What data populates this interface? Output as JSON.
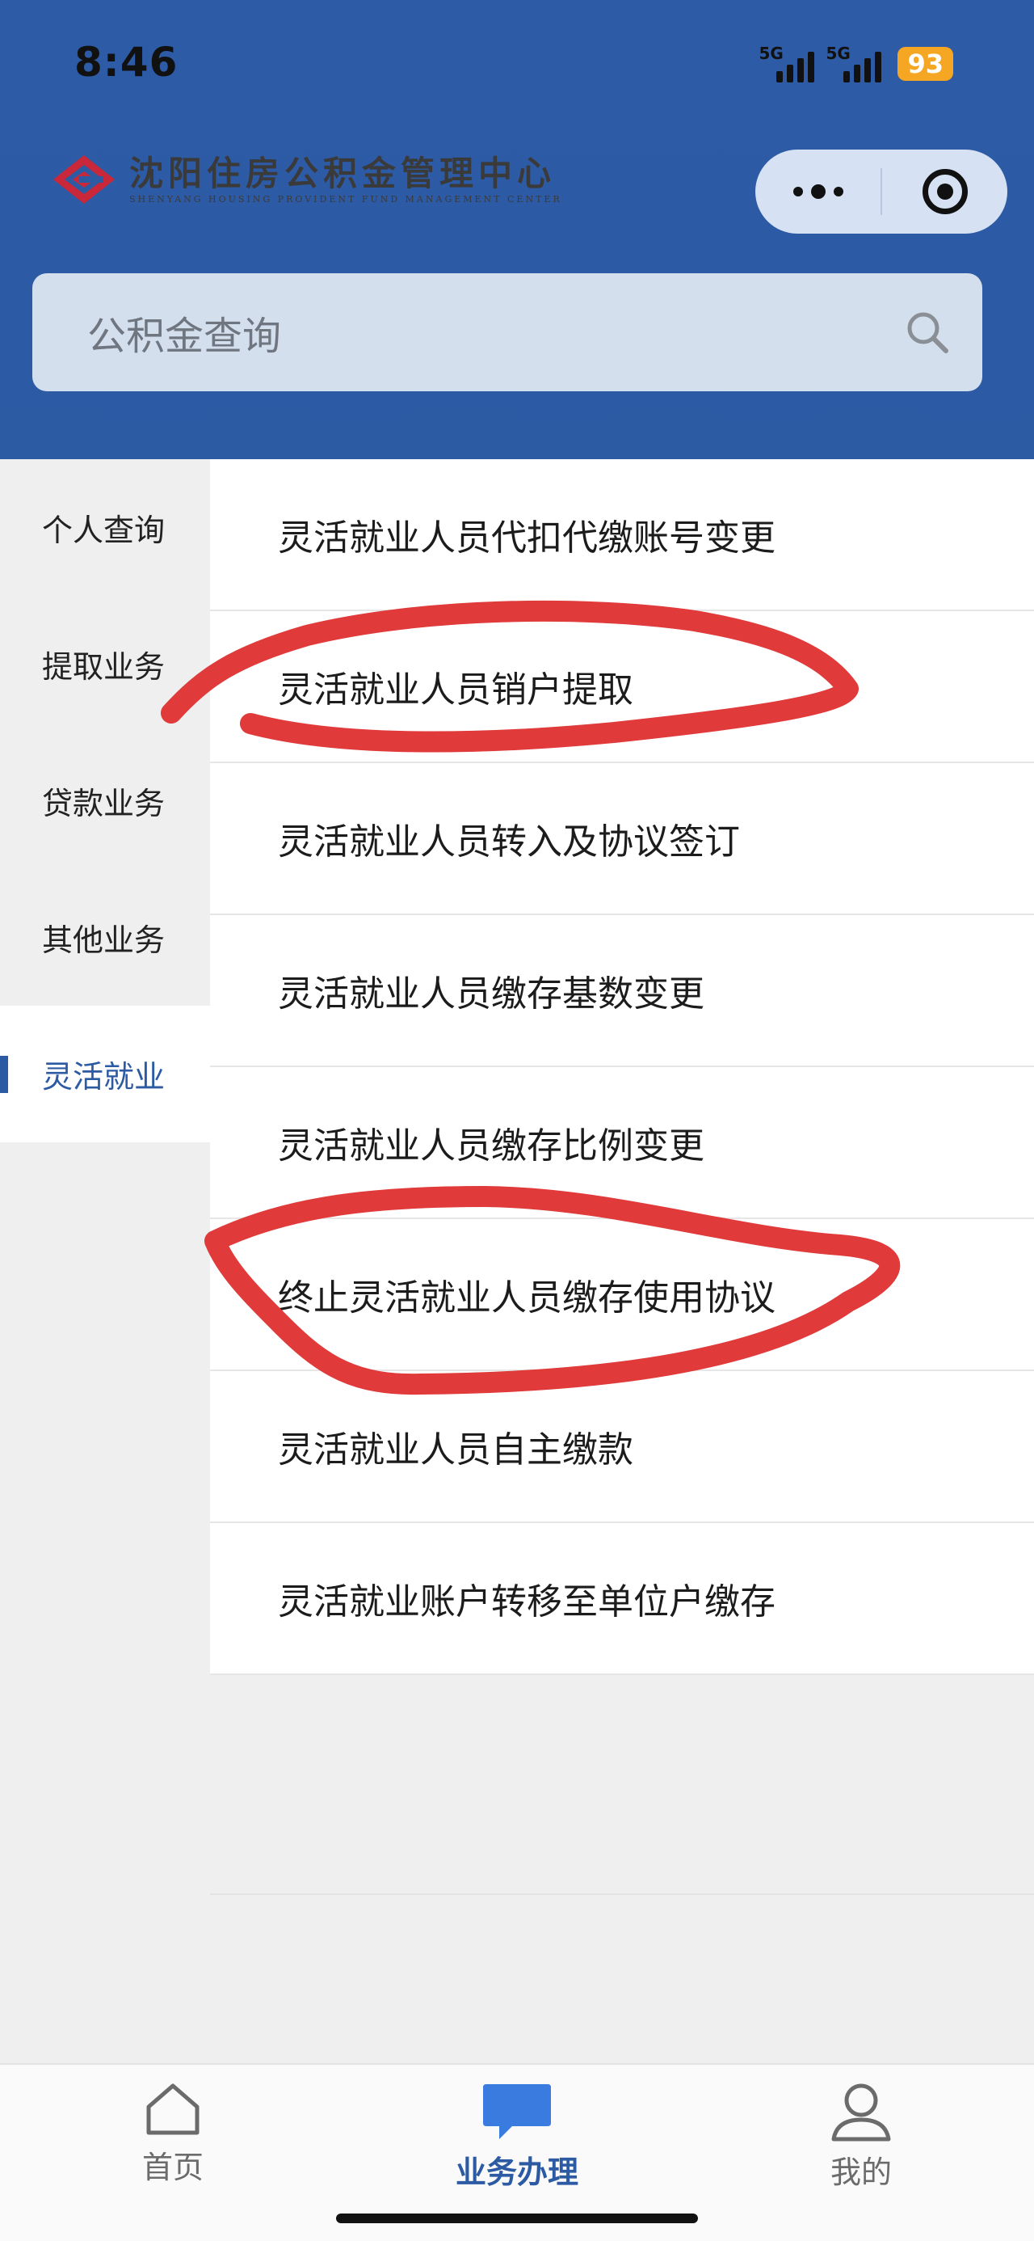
{
  "status_bar": {
    "time": "8:46",
    "signal_1": "5G",
    "signal_2": "5G",
    "battery": "93"
  },
  "header": {
    "logo_cn": "沈阳住房公积金管理中心",
    "logo_en": "SHENYANG HOUSING PROVIDENT FUND MANAGEMENT CENTER",
    "brand_color": "#2c5aa3"
  },
  "search": {
    "placeholder": "公积金查询"
  },
  "sidebar": {
    "items": [
      {
        "label": "个人查询"
      },
      {
        "label": "提取业务"
      },
      {
        "label": "贷款业务"
      },
      {
        "label": "其他业务"
      },
      {
        "label": "灵活就业"
      }
    ],
    "active_index": 4
  },
  "list": {
    "items": [
      {
        "label": "灵活就业人员代扣代缴账号变更"
      },
      {
        "label": "灵活就业人员销户提取"
      },
      {
        "label": "灵活就业人员转入及协议签订"
      },
      {
        "label": "灵活就业人员缴存基数变更"
      },
      {
        "label": "灵活就业人员缴存比例变更"
      },
      {
        "label": "终止灵活就业人员缴存使用协议"
      },
      {
        "label": "灵活就业人员自主缴款"
      },
      {
        "label": "灵活就业账户转移至单位户缴存"
      }
    ]
  },
  "annotations": {
    "color": "#e03a3a",
    "circled": [
      "灵活就业人员销户提取",
      "终止灵活就业人员缴存使用协议"
    ]
  },
  "tabbar": {
    "tabs": [
      {
        "label": "首页",
        "icon": "home-icon"
      },
      {
        "label": "业务办理",
        "icon": "chat-bubble-icon"
      },
      {
        "label": "我的",
        "icon": "user-icon"
      }
    ],
    "active_index": 1
  }
}
